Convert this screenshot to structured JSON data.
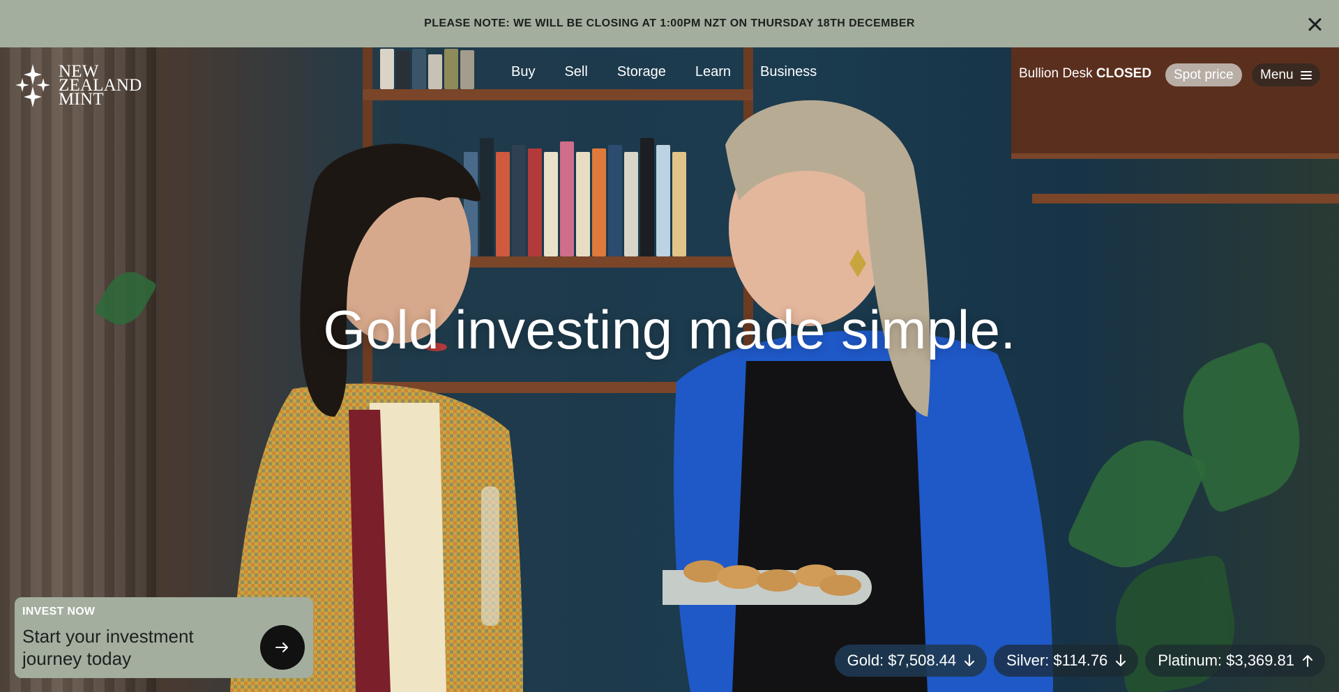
{
  "notice": {
    "text": "PLEASE NOTE: WE WILL BE CLOSING AT 1:00PM NZT ON THURSDAY 18TH DECEMBER",
    "close_icon": "close-icon"
  },
  "logo": {
    "line1": "NEW",
    "line2": "ZEALAND",
    "line3": "MINT",
    "icon": "sparkle-stars-icon"
  },
  "nav": {
    "items": [
      {
        "label": "Buy"
      },
      {
        "label": "Sell"
      },
      {
        "label": "Storage"
      },
      {
        "label": "Learn"
      },
      {
        "label": "Business"
      }
    ]
  },
  "header": {
    "desk_label": "Bullion Desk",
    "desk_status": "CLOSED",
    "spot_price_label": "Spot price",
    "menu_label": "Menu",
    "menu_icon": "hamburger-icon"
  },
  "hero": {
    "headline": "Gold investing made simple."
  },
  "invest": {
    "kicker": "INVEST NOW",
    "title": "Start your investment journey today",
    "arrow_icon": "arrow-right-icon"
  },
  "prices": [
    {
      "label": "Gold: $7,508.44",
      "direction": "down",
      "icon": "arrow-down-icon"
    },
    {
      "label": "Silver: $114.76",
      "direction": "down",
      "icon": "arrow-down-icon"
    },
    {
      "label": "Platinum: $3,369.81",
      "direction": "up",
      "icon": "arrow-up-icon"
    }
  ],
  "colors": {
    "sage": "#a3ae9f",
    "dark": "#1d1f1d",
    "navy_pill": "#1e3a52"
  }
}
